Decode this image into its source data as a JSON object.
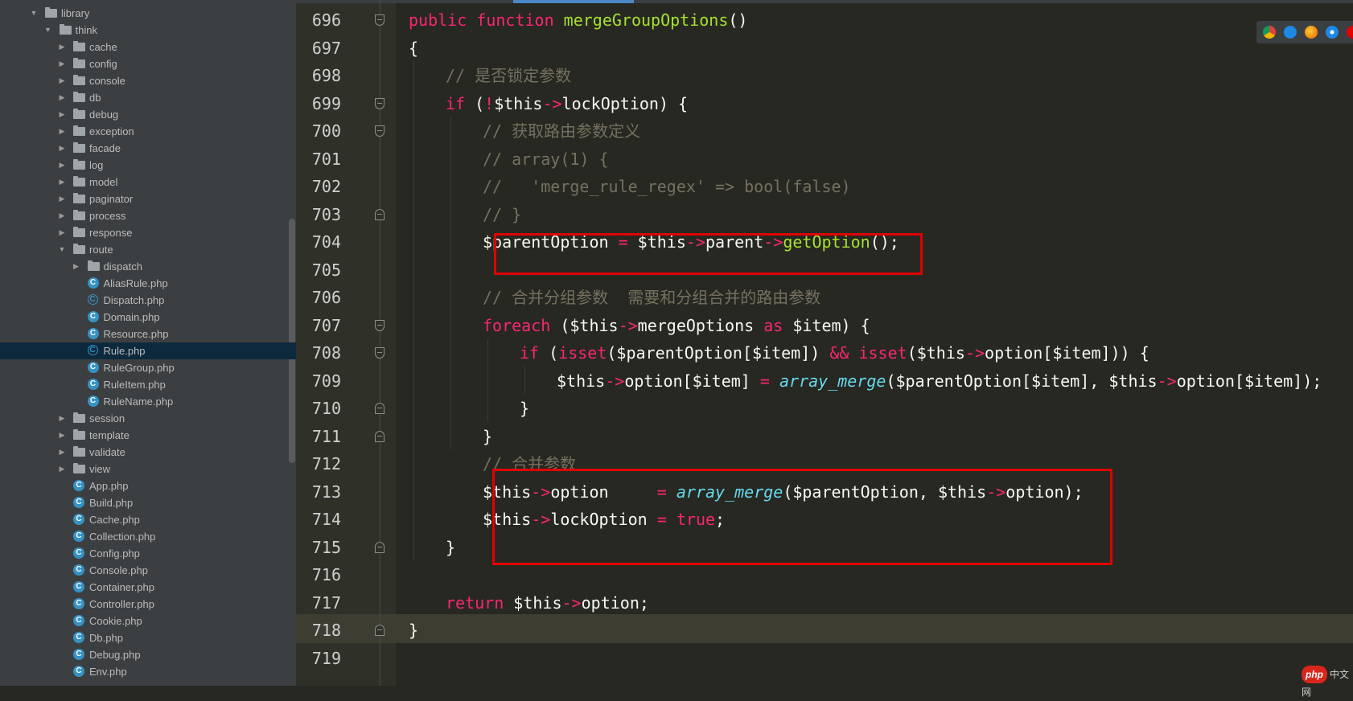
{
  "sidebar": {
    "tree": [
      {
        "label": "library",
        "kind": "folder",
        "depth": 0,
        "state": "expanded"
      },
      {
        "label": "think",
        "kind": "folder",
        "depth": 1,
        "state": "expanded"
      },
      {
        "label": "cache",
        "kind": "folder",
        "depth": 2,
        "state": "collapsed"
      },
      {
        "label": "config",
        "kind": "folder",
        "depth": 2,
        "state": "collapsed"
      },
      {
        "label": "console",
        "kind": "folder",
        "depth": 2,
        "state": "collapsed"
      },
      {
        "label": "db",
        "kind": "folder",
        "depth": 2,
        "state": "collapsed"
      },
      {
        "label": "debug",
        "kind": "folder",
        "depth": 2,
        "state": "collapsed"
      },
      {
        "label": "exception",
        "kind": "folder",
        "depth": 2,
        "state": "collapsed"
      },
      {
        "label": "facade",
        "kind": "folder",
        "depth": 2,
        "state": "collapsed"
      },
      {
        "label": "log",
        "kind": "folder",
        "depth": 2,
        "state": "collapsed"
      },
      {
        "label": "model",
        "kind": "folder",
        "depth": 2,
        "state": "collapsed"
      },
      {
        "label": "paginator",
        "kind": "folder",
        "depth": 2,
        "state": "collapsed"
      },
      {
        "label": "process",
        "kind": "folder",
        "depth": 2,
        "state": "collapsed"
      },
      {
        "label": "response",
        "kind": "folder",
        "depth": 2,
        "state": "collapsed"
      },
      {
        "label": "route",
        "kind": "folder",
        "depth": 2,
        "state": "expanded"
      },
      {
        "label": "dispatch",
        "kind": "folder",
        "depth": 3,
        "state": "collapsed"
      },
      {
        "label": "AliasRule.php",
        "kind": "class",
        "depth": 3
      },
      {
        "label": "Dispatch.php",
        "kind": "abstract",
        "depth": 3
      },
      {
        "label": "Domain.php",
        "kind": "class",
        "depth": 3
      },
      {
        "label": "Resource.php",
        "kind": "class",
        "depth": 3
      },
      {
        "label": "Rule.php",
        "kind": "abstract",
        "depth": 3,
        "selected": true
      },
      {
        "label": "RuleGroup.php",
        "kind": "class",
        "depth": 3
      },
      {
        "label": "RuleItem.php",
        "kind": "class",
        "depth": 3
      },
      {
        "label": "RuleName.php",
        "kind": "class",
        "depth": 3
      },
      {
        "label": "session",
        "kind": "folder",
        "depth": 2,
        "state": "collapsed"
      },
      {
        "label": "template",
        "kind": "folder",
        "depth": 2,
        "state": "collapsed"
      },
      {
        "label": "validate",
        "kind": "folder",
        "depth": 2,
        "state": "collapsed"
      },
      {
        "label": "view",
        "kind": "folder",
        "depth": 2,
        "state": "collapsed"
      },
      {
        "label": "App.php",
        "kind": "class",
        "depth": 2
      },
      {
        "label": "Build.php",
        "kind": "class",
        "depth": 2
      },
      {
        "label": "Cache.php",
        "kind": "class",
        "depth": 2
      },
      {
        "label": "Collection.php",
        "kind": "class",
        "depth": 2
      },
      {
        "label": "Config.php",
        "kind": "class",
        "depth": 2
      },
      {
        "label": "Console.php",
        "kind": "class",
        "depth": 2
      },
      {
        "label": "Container.php",
        "kind": "class",
        "depth": 2
      },
      {
        "label": "Controller.php",
        "kind": "class",
        "depth": 2
      },
      {
        "label": "Cookie.php",
        "kind": "class",
        "depth": 2
      },
      {
        "label": "Db.php",
        "kind": "class",
        "depth": 2
      },
      {
        "label": "Debug.php",
        "kind": "class",
        "depth": 2
      },
      {
        "label": "Env.php",
        "kind": "class",
        "depth": 2
      }
    ]
  },
  "editor": {
    "lines": [
      {
        "num": "696",
        "fold": "open",
        "indent": 1,
        "tokens": [
          [
            "kw",
            "public "
          ],
          [
            "kw",
            "function "
          ],
          [
            "fn",
            "mergeGroupOptions"
          ],
          [
            "",
            "()"
          ]
        ]
      },
      {
        "num": "697",
        "fold": "",
        "indent": 1,
        "tokens": [
          [
            "",
            "{"
          ]
        ]
      },
      {
        "num": "698",
        "fold": "",
        "indent": 2,
        "tokens": [
          [
            "cm",
            "// 是否锁定参数"
          ]
        ]
      },
      {
        "num": "699",
        "fold": "open",
        "indent": 2,
        "tokens": [
          [
            "kw",
            "if "
          ],
          [
            "",
            "("
          ],
          [
            "op",
            "!"
          ],
          [
            "",
            "$this"
          ],
          [
            "op",
            "->"
          ],
          [
            "",
            "lockOption) {"
          ]
        ]
      },
      {
        "num": "700",
        "fold": "open",
        "indent": 3,
        "tokens": [
          [
            "cm",
            "// 获取路由参数定义"
          ]
        ]
      },
      {
        "num": "701",
        "fold": "",
        "indent": 3,
        "tokens": [
          [
            "cm",
            "// array(1) {"
          ]
        ]
      },
      {
        "num": "702",
        "fold": "",
        "indent": 3,
        "tokens": [
          [
            "cm",
            "//   'merge_rule_regex' => bool(false)"
          ]
        ]
      },
      {
        "num": "703",
        "fold": "close",
        "indent": 3,
        "tokens": [
          [
            "cm",
            "// }"
          ]
        ]
      },
      {
        "num": "704",
        "fold": "",
        "indent": 3,
        "tokens": [
          [
            "",
            "$parentOption "
          ],
          [
            "op",
            "= "
          ],
          [
            "",
            "$this"
          ],
          [
            "op",
            "->"
          ],
          [
            "",
            "parent"
          ],
          [
            "op",
            "->"
          ],
          [
            "fn",
            "getOption"
          ],
          [
            "",
            "();"
          ]
        ]
      },
      {
        "num": "705",
        "fold": "",
        "indent": 3,
        "tokens": []
      },
      {
        "num": "706",
        "fold": "",
        "indent": 3,
        "tokens": [
          [
            "cm",
            "// 合并分组参数  需要和分组合并的路由参数"
          ]
        ]
      },
      {
        "num": "707",
        "fold": "open",
        "indent": 3,
        "tokens": [
          [
            "kw",
            "foreach "
          ],
          [
            "",
            "($this"
          ],
          [
            "op",
            "->"
          ],
          [
            "",
            "mergeOptions "
          ],
          [
            "kw",
            "as "
          ],
          [
            "",
            "$item) {"
          ]
        ]
      },
      {
        "num": "708",
        "fold": "open",
        "indent": 4,
        "tokens": [
          [
            "kw",
            "if "
          ],
          [
            "",
            "("
          ],
          [
            "kw",
            "isset"
          ],
          [
            "",
            "($parentOption[$item]) "
          ],
          [
            "op",
            "&& "
          ],
          [
            "kw",
            "isset"
          ],
          [
            "",
            "($this"
          ],
          [
            "op",
            "->"
          ],
          [
            "",
            "option[$item])) {"
          ]
        ]
      },
      {
        "num": "709",
        "fold": "",
        "indent": 5,
        "tokens": [
          [
            "",
            "$this"
          ],
          [
            "op",
            "->"
          ],
          [
            "",
            "option[$item] "
          ],
          [
            "op",
            "= "
          ],
          [
            "it",
            "array_merge"
          ],
          [
            "",
            "($parentOption[$item], $this"
          ],
          [
            "op",
            "->"
          ],
          [
            "",
            "option[$item]);"
          ]
        ]
      },
      {
        "num": "710",
        "fold": "close",
        "indent": 4,
        "tokens": [
          [
            "",
            "}"
          ]
        ]
      },
      {
        "num": "711",
        "fold": "close",
        "indent": 3,
        "tokens": [
          [
            "",
            "}"
          ]
        ]
      },
      {
        "num": "712",
        "fold": "",
        "indent": 3,
        "tokens": [
          [
            "cm",
            "// 合并参数"
          ]
        ]
      },
      {
        "num": "713",
        "fold": "",
        "indent": 3,
        "tokens": [
          [
            "",
            "$this"
          ],
          [
            "op",
            "->"
          ],
          [
            "",
            "option     "
          ],
          [
            "op",
            "= "
          ],
          [
            "it",
            "array_merge"
          ],
          [
            "",
            "($parentOption, $this"
          ],
          [
            "op",
            "->"
          ],
          [
            "",
            "option);"
          ]
        ]
      },
      {
        "num": "714",
        "fold": "",
        "indent": 3,
        "tokens": [
          [
            "",
            "$this"
          ],
          [
            "op",
            "->"
          ],
          [
            "",
            "lockOption "
          ],
          [
            "op",
            "= "
          ],
          [
            "kw",
            "true"
          ],
          [
            "",
            ";"
          ]
        ]
      },
      {
        "num": "715",
        "fold": "close",
        "indent": 2,
        "tokens": [
          [
            "",
            "}"
          ]
        ]
      },
      {
        "num": "716",
        "fold": "",
        "indent": 2,
        "tokens": []
      },
      {
        "num": "717",
        "fold": "",
        "indent": 2,
        "tokens": [
          [
            "kw",
            "return "
          ],
          [
            "",
            "$this"
          ],
          [
            "op",
            "->"
          ],
          [
            "",
            "option;"
          ]
        ]
      },
      {
        "num": "718",
        "fold": "close",
        "indent": 1,
        "tokens": [
          [
            "",
            "}"
          ]
        ]
      },
      {
        "num": "719",
        "fold": "",
        "indent": 1,
        "tokens": []
      }
    ]
  },
  "browser_icons": [
    "chrome-icon",
    "edge-icon",
    "firefox-icon",
    "safari-icon",
    "opera-icon"
  ],
  "watermark": {
    "logo": "php",
    "text": "中文网"
  },
  "colors": {
    "accent_red": "#e00000",
    "keyword": "#f92672",
    "function": "#a6e22e",
    "comment": "#75715e",
    "builtin": "#66d9ef"
  }
}
